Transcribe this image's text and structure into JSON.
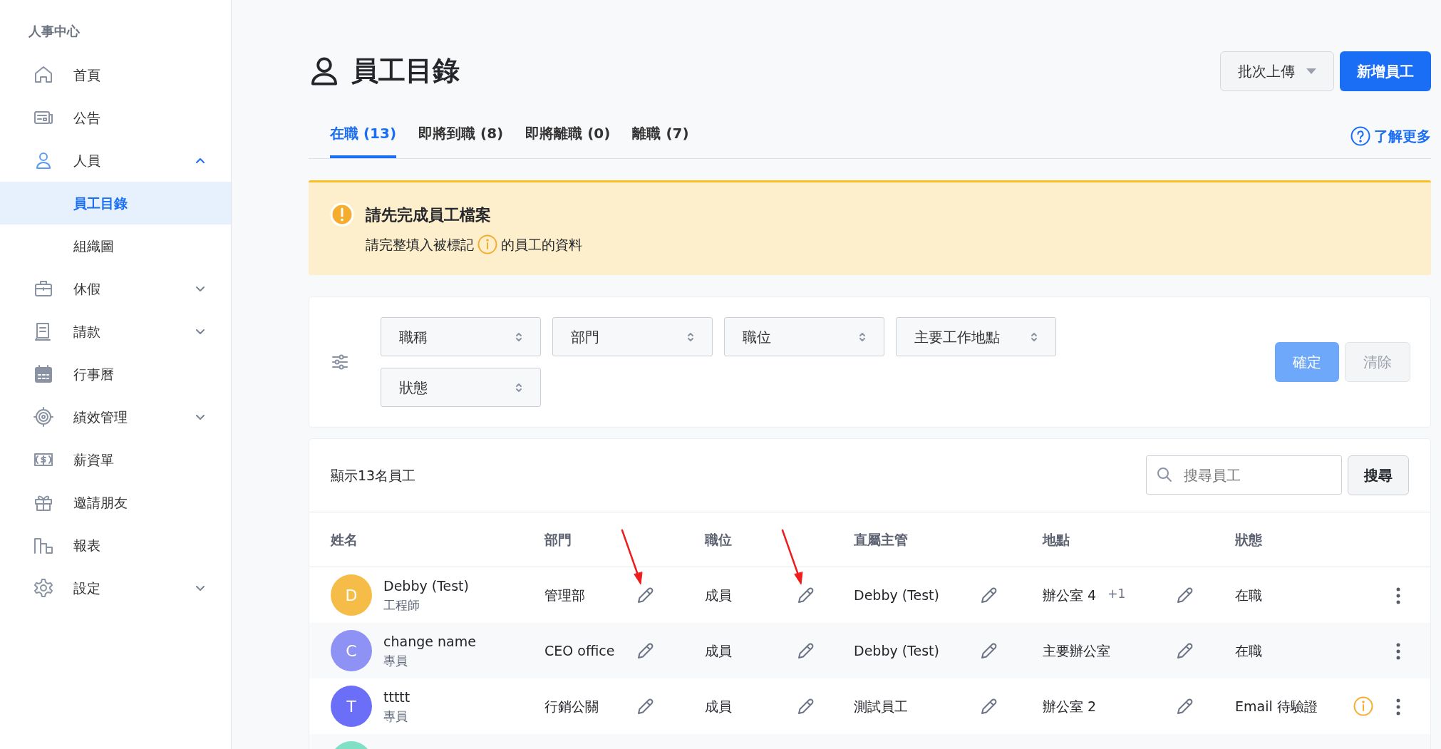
{
  "sidebar": {
    "heading": "人事中心",
    "items": [
      {
        "label": "首頁",
        "selected": false
      },
      {
        "label": "公告",
        "selected": false
      },
      {
        "label": "人員",
        "selected": false,
        "expanded": true,
        "children": [
          {
            "label": "員工目錄",
            "selected": true
          },
          {
            "label": "組織圖",
            "selected": false
          }
        ]
      },
      {
        "label": "休假",
        "selected": false,
        "expanded": false
      },
      {
        "label": "請款",
        "selected": false,
        "expanded": false
      },
      {
        "label": "行事曆",
        "selected": false
      },
      {
        "label": "績效管理",
        "selected": false,
        "expanded": false
      },
      {
        "label": "薪資單",
        "selected": false
      },
      {
        "label": "邀請朋友",
        "selected": false
      },
      {
        "label": "報表",
        "selected": false
      },
      {
        "label": "設定",
        "selected": false,
        "expanded": false
      }
    ]
  },
  "header": {
    "title": "員工目錄",
    "batch_button": "批次上傳",
    "add_button": "新增員工"
  },
  "tabs": [
    {
      "label": "在職 (13)",
      "selected": true
    },
    {
      "label": "即將到職 (8)",
      "selected": false
    },
    {
      "label": "即將離職 (0)",
      "selected": false
    },
    {
      "label": "離職 (7)",
      "selected": false
    }
  ],
  "help_link": "了解更多",
  "banner": {
    "title": "請先完成員工檔案",
    "text_before": "請完整填入被標記",
    "text_after": "的員工的資料"
  },
  "filters": {
    "selects": [
      "職稱",
      "部門",
      "職位",
      "主要工作地點",
      "狀態"
    ],
    "confirm": {
      "label": "確定",
      "disabled": true
    },
    "clear": {
      "label": "清除",
      "disabled": true
    }
  },
  "table": {
    "count": "顯示13名員工",
    "search_placeholder": "搜尋員工",
    "search_button": "搜尋",
    "columns": [
      "姓名",
      "部門",
      "職位",
      "直屬主管",
      "地點",
      "狀態"
    ],
    "rows": [
      {
        "initial": "D",
        "color": "#f5bd47",
        "name": "Debby (Test)",
        "job": "工程師",
        "dept": "管理部",
        "position": "成員",
        "manager": "Debby (Test)",
        "location": "辦公室 4",
        "location_extra": "+1",
        "status": "在職",
        "warning": false,
        "dept_arrow": true,
        "position_arrow": true
      },
      {
        "initial": "C",
        "color": "#8e92f4",
        "name": "change name",
        "job": "專員",
        "dept": "CEO office",
        "position": "成員",
        "manager": "Debby (Test)",
        "location": "主要辦公室",
        "status": "在職",
        "warning": false,
        "dept_arrow": false,
        "position_arrow": false
      },
      {
        "initial": "T",
        "color": "#6b6ef6",
        "name": "ttttt",
        "job": "專員",
        "dept": "行銷公關",
        "position": "成員",
        "manager": "測試員工",
        "location": "辦公室 2",
        "status": "Email 待驗證",
        "warning": true,
        "dept_arrow": false,
        "position_arrow": false
      },
      {
        "color": "#7fe0c6"
      }
    ]
  }
}
